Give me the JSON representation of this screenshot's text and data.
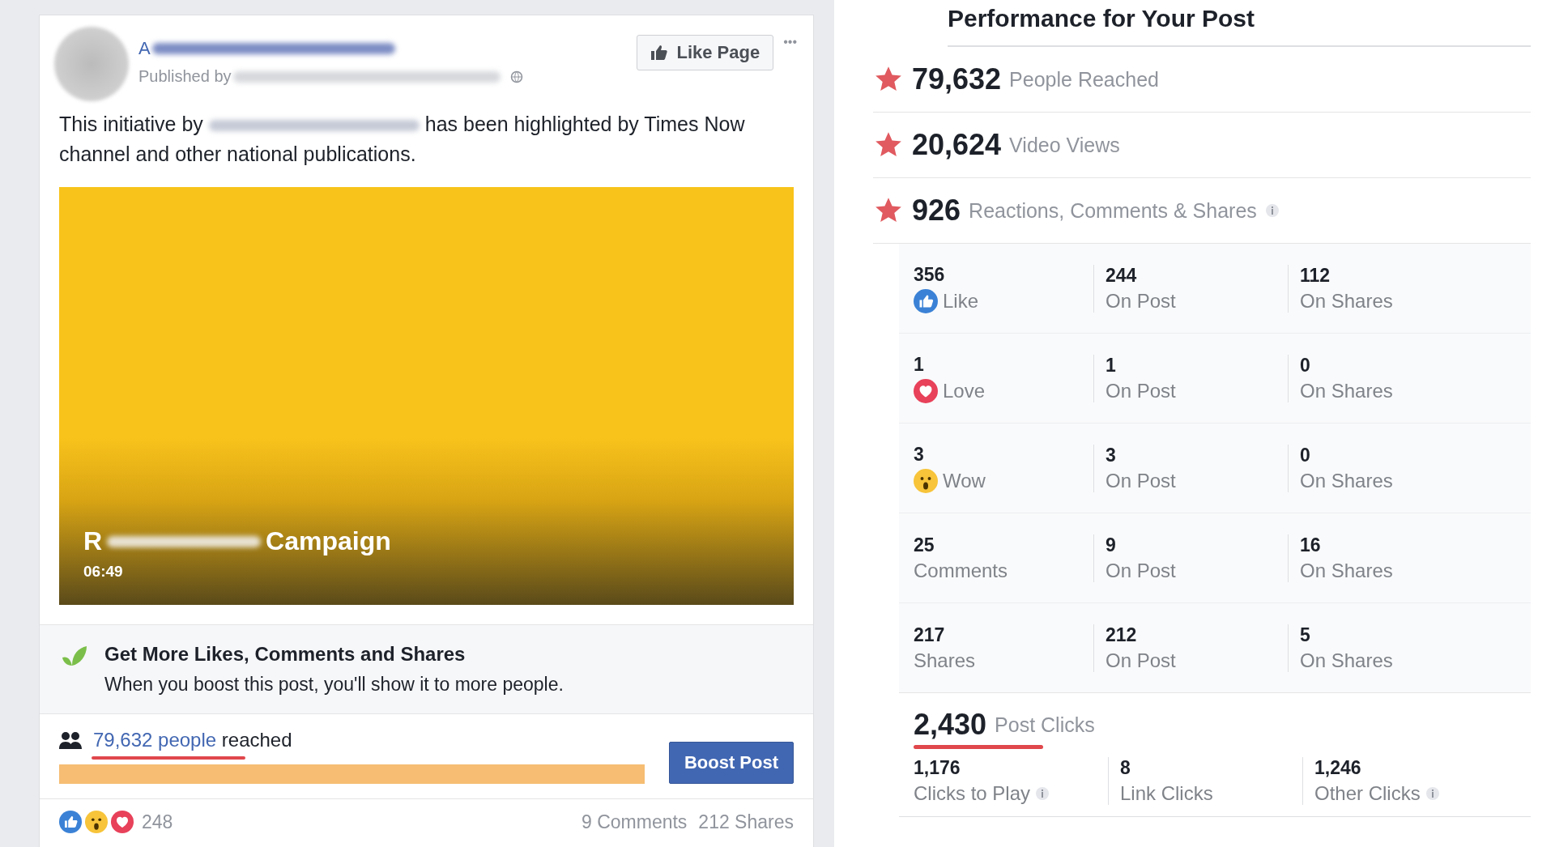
{
  "post": {
    "author_visible": "A",
    "published_by": "Published by",
    "sentence_start": "This initiative by",
    "sentence_end": "has been highlighted by Times Now channel and other national publications.",
    "like_page": "Like Page",
    "more": "•••",
    "video": {
      "title_start": "R",
      "title_end": "Campaign",
      "duration": "06:49"
    },
    "boost": {
      "title": "Get More Likes, Comments and Shares",
      "text": "When you boost this post, you'll show it to more people."
    },
    "reach": {
      "count": "79,632 people",
      "suffix": "reached",
      "level": 1,
      "button": "Boost Post"
    },
    "footer": {
      "reaction_count": "248",
      "comments": "9 Comments",
      "shares": "212 Shares"
    }
  },
  "performance": {
    "title": "Performance for Your Post",
    "headlines": [
      {
        "value": "79,632",
        "label": "People Reached",
        "info": false
      },
      {
        "value": "20,624",
        "label": "Video Views",
        "info": false
      },
      {
        "value": "926",
        "label": "Reactions, Comments & Shares",
        "info": true
      }
    ],
    "breakdown": [
      {
        "kind": "like",
        "cells": [
          {
            "value": "356",
            "label": "Like"
          },
          {
            "value": "244",
            "label": "On Post"
          },
          {
            "value": "112",
            "label": "On Shares"
          }
        ]
      },
      {
        "kind": "love",
        "cells": [
          {
            "value": "1",
            "label": "Love"
          },
          {
            "value": "1",
            "label": "On Post"
          },
          {
            "value": "0",
            "label": "On Shares"
          }
        ]
      },
      {
        "kind": "wow",
        "cells": [
          {
            "value": "3",
            "label": "Wow"
          },
          {
            "value": "3",
            "label": "On Post"
          },
          {
            "value": "0",
            "label": "On Shares"
          }
        ]
      },
      {
        "kind": "plain",
        "cells": [
          {
            "value": "25",
            "label": "Comments"
          },
          {
            "value": "9",
            "label": "On Post"
          },
          {
            "value": "16",
            "label": "On Shares"
          }
        ]
      },
      {
        "kind": "plain",
        "cells": [
          {
            "value": "217",
            "label": "Shares"
          },
          {
            "value": "212",
            "label": "On Post"
          },
          {
            "value": "5",
            "label": "On Shares"
          }
        ]
      }
    ],
    "clicks": {
      "value": "2,430",
      "label": "Post Clicks",
      "cells": [
        {
          "value": "1,176",
          "label": "Clicks to Play",
          "info": true
        },
        {
          "value": "8",
          "label": "Link Clicks",
          "info": false
        },
        {
          "value": "1,246",
          "label": "Other Clicks",
          "info": true
        }
      ]
    }
  }
}
